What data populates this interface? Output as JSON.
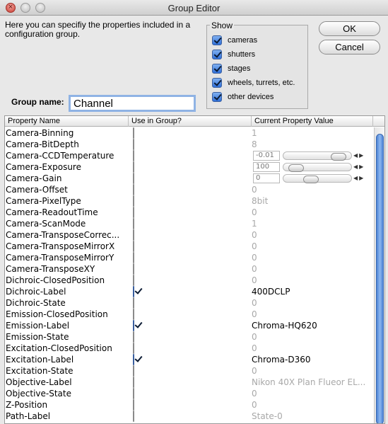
{
  "window": {
    "title": "Group Editor"
  },
  "intro_text": "Here you can specifiy the properties included in a configuration group.",
  "show": {
    "legend": "Show",
    "items": [
      {
        "label": "cameras",
        "checked": true
      },
      {
        "label": "shutters",
        "checked": true
      },
      {
        "label": "stages",
        "checked": true
      },
      {
        "label": "wheels, turrets, etc.",
        "checked": true
      },
      {
        "label": "other devices",
        "checked": true
      }
    ]
  },
  "buttons": {
    "ok": "OK",
    "cancel": "Cancel"
  },
  "group_name": {
    "label": "Group name:",
    "value": "Channel"
  },
  "table": {
    "headers": [
      "Property Name",
      "Use in Group?",
      "Current Property Value"
    ],
    "rows": [
      {
        "name": "Camera-Binning",
        "use": false,
        "value": "1"
      },
      {
        "name": "Camera-BitDepth",
        "use": false,
        "value": "8"
      },
      {
        "name": "Camera-CCDTemperature",
        "use": false,
        "value": "-0.01",
        "slider": 0.9
      },
      {
        "name": "Camera-Exposure",
        "use": false,
        "value": "100",
        "slider": 0.1
      },
      {
        "name": "Camera-Gain",
        "use": false,
        "value": "0",
        "slider": 0.38
      },
      {
        "name": "Camera-Offset",
        "use": false,
        "value": "0"
      },
      {
        "name": "Camera-PixelType",
        "use": false,
        "value": "8bit"
      },
      {
        "name": "Camera-ReadoutTime",
        "use": false,
        "value": "0"
      },
      {
        "name": "Camera-ScanMode",
        "use": false,
        "value": "1"
      },
      {
        "name": "Camera-TransposeCorrec...",
        "use": false,
        "value": "0"
      },
      {
        "name": "Camera-TransposeMirrorX",
        "use": false,
        "value": "0"
      },
      {
        "name": "Camera-TransposeMirrorY",
        "use": false,
        "value": "0"
      },
      {
        "name": "Camera-TransposeXY",
        "use": false,
        "value": "0"
      },
      {
        "name": "Dichroic-ClosedPosition",
        "use": false,
        "value": "0"
      },
      {
        "name": "Dichroic-Label",
        "use": true,
        "value": "400DCLP"
      },
      {
        "name": "Dichroic-State",
        "use": false,
        "value": "0"
      },
      {
        "name": "Emission-ClosedPosition",
        "use": false,
        "value": "0"
      },
      {
        "name": "Emission-Label",
        "use": true,
        "value": "Chroma-HQ620"
      },
      {
        "name": "Emission-State",
        "use": false,
        "value": "0"
      },
      {
        "name": "Excitation-ClosedPosition",
        "use": false,
        "value": "0"
      },
      {
        "name": "Excitation-Label",
        "use": true,
        "value": "Chroma-D360"
      },
      {
        "name": "Excitation-State",
        "use": false,
        "value": "0"
      },
      {
        "name": "Objective-Label",
        "use": false,
        "value": "Nikon 40X Plan Flueor EL..."
      },
      {
        "name": "Objective-State",
        "use": false,
        "value": "0"
      },
      {
        "name": "Z-Position",
        "use": false,
        "value": "0"
      },
      {
        "name": "Path-Label",
        "use": false,
        "value": "State-0"
      }
    ]
  }
}
